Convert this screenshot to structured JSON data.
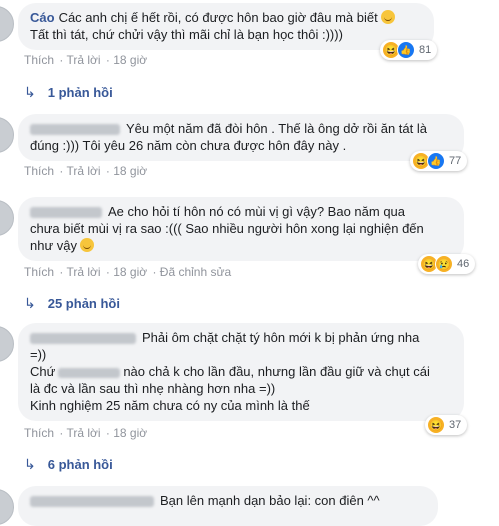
{
  "comments": [
    {
      "author": "Cáo",
      "lines": [
        "Các anh chị ế hết rồi, có được hôn bao giờ đâu mà biết",
        "Tất thì tát, chứ chửi vậy thì mãi chỉ là bạn học thôi :))))"
      ],
      "reactions": {
        "icons": [
          "haha-icon",
          "like-icon"
        ],
        "count": "81"
      },
      "actions": {
        "like": "Thích",
        "reply": "Trả lời",
        "time": "18 giờ"
      },
      "replies": "1 phản hồi"
    },
    {
      "author": "",
      "lines": [
        "Yêu một năm đã đòi hôn . Thế là ông dở rồi ăn tát là",
        "đúng :))) Tôi yêu 26 năm còn chưa được hôn đây này ."
      ],
      "reactions": {
        "icons": [
          "haha-icon",
          "like-icon"
        ],
        "count": "77"
      },
      "actions": {
        "like": "Thích",
        "reply": "Trả lời",
        "time": "18 giờ"
      }
    },
    {
      "author": "",
      "lines": [
        "Ae cho hỏi tí hôn nó có mùi vị gì vậy? Bao năm qua",
        "chưa biết mùi vị ra sao :((( Sao nhiều người hôn xong lại nghiện đến",
        "như vậy"
      ],
      "reactions": {
        "icons": [
          "haha-icon",
          "sad-icon"
        ],
        "count": "46"
      },
      "actions": {
        "like": "Thích",
        "reply": "Trả lời",
        "time": "18 giờ",
        "edited": "Đã chỉnh sửa"
      },
      "replies": "25 phản hồi"
    },
    {
      "author": "",
      "lines": [
        "Phải ôm chặt chặt tý hôn mới k bị phản ứng nha",
        "=))",
        "Chứ",
        "nào chả k cho lần đầu, nhưng lần đầu giữ và chụt cái",
        "là đc và lần sau thì nhẹ nhàng hơn nha =))",
        "Kinh nghiệm 25 năm chưa có ny của mình là thế"
      ],
      "reactions": {
        "icons": [
          "haha-icon"
        ],
        "count": "37"
      },
      "actions": {
        "like": "Thích",
        "reply": "Trả lời",
        "time": "18 giờ"
      },
      "replies": "6 phản hồi"
    },
    {
      "author": "",
      "lines": [
        "Bạn lên mạnh dạn bảo lại: con điên ^^"
      ]
    }
  ]
}
